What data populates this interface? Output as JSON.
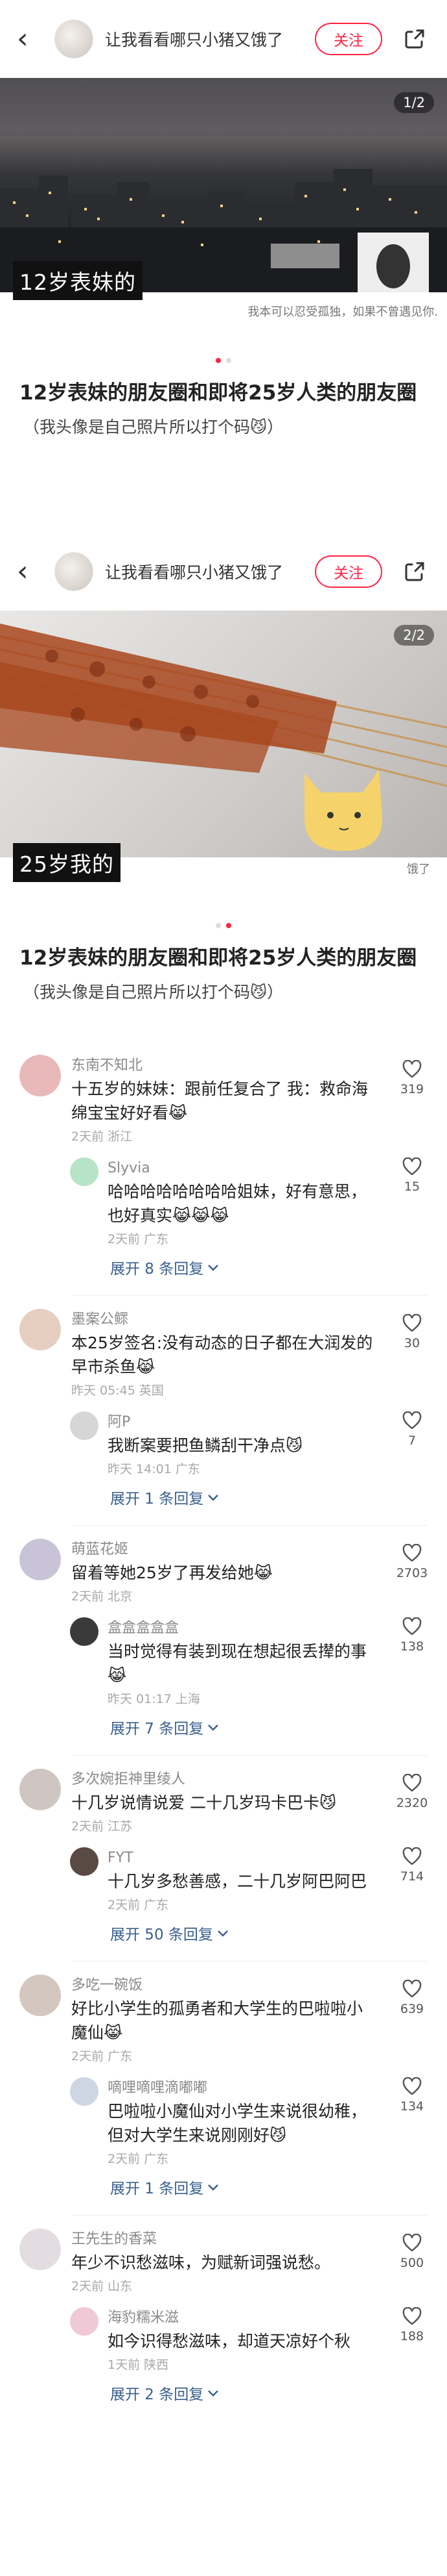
{
  "post1": {
    "header": {
      "username": "让我看看哪只小猪又饿了",
      "follow": "关注"
    },
    "page_indicator": "1/2",
    "caption": "12岁表妹的",
    "small_caption": "我本可以忍受孤独，如果不曾遇见你.",
    "title": "12岁表妹的朋友圈和即将25岁人类的朋友圈",
    "subtitle": "（我头像是自己照片所以打个码😼）"
  },
  "post2": {
    "header": {
      "username": "让我看看哪只小猪又饿了",
      "follow": "关注"
    },
    "page_indicator": "2/2",
    "caption": "25岁我的",
    "small_caption": "饿了",
    "title": "12岁表妹的朋友圈和即将25岁人类的朋友圈",
    "subtitle": "（我头像是自己照片所以打个码😼）"
  },
  "comments": [
    {
      "name": "东南不知北",
      "text": "十五岁的妹妹：跟前任复合了 我：救命海绵宝宝好好看😹",
      "meta": "2天前 浙江",
      "likes": "319",
      "avatar_color": "#e9b8b8",
      "replies": [
        {
          "name": "Slyvia",
          "text": "哈哈哈哈哈哈哈哈姐妹，好有意思，也好真实😹😹😹",
          "meta": "2天前 广东",
          "likes": "15",
          "avatar_color": "#b7e3c6"
        }
      ],
      "expand": "展开 8 条回复"
    },
    {
      "name": "墨案公鳏",
      "text": "本25岁签名:没有动态的日子都在大润发的早市杀鱼😹",
      "meta": "昨天 05:45 英国",
      "likes": "30",
      "avatar_color": "#e6cfc0",
      "replies": [
        {
          "name": "阿P",
          "text": "我断案要把鱼鳞刮干净点😼",
          "meta": "昨天 14:01 广东",
          "likes": "7",
          "avatar_color": "#d6d6d6"
        }
      ],
      "expand": "展开 1 条回复"
    },
    {
      "name": "萌蓝花姬",
      "text": "留着等她25岁了再发给她😹",
      "meta": "2天前 北京",
      "likes": "2703",
      "avatar_color": "#c9c3d8",
      "replies": [
        {
          "name": "盒盒盒盒盒",
          "text": "当时觉得有装到现在想起很丢撵的事😹",
          "meta": "昨天 01:17 上海",
          "likes": "138",
          "avatar_color": "#3a3a3a"
        }
      ],
      "expand": "展开 7 条回复"
    },
    {
      "name": "多次婉拒神里绫人",
      "text": "十几岁说情说爱 二十几岁玛卡巴卡😼",
      "meta": "2天前 江苏",
      "likes": "2320",
      "avatar_color": "#cfc6c1",
      "replies": [
        {
          "name": "FYT",
          "text": "十几岁多愁善感，二十几岁阿巴阿巴",
          "meta": "2天前 广东",
          "likes": "714",
          "avatar_color": "#5a4a44"
        }
      ],
      "expand": "展开 50 条回复"
    },
    {
      "name": "多吃一碗饭",
      "text": "好比小学生的孤勇者和大学生的巴啦啦小魔仙😹",
      "meta": "2天前 广东",
      "likes": "639",
      "avatar_color": "#d3c7c0",
      "replies": [
        {
          "name": "嘀哩嘀哩滴嘟嘟",
          "text": "巴啦啦小魔仙对小学生来说很幼稚，但对大学生来说刚刚好😼",
          "meta": "2天前 广东",
          "likes": "134",
          "avatar_color": "#cdd6e2"
        }
      ],
      "expand": "展开 1 条回复"
    },
    {
      "name": "王先生的香菜",
      "text": "年少不识愁滋味，为赋新词强说愁。",
      "meta": "2天前 山东",
      "likes": "500",
      "avatar_color": "#e3dde2",
      "replies": [
        {
          "name": "海豹糯米滋",
          "text": "如今识得愁滋味，却道天凉好个秋",
          "meta": "1天前 陕西",
          "likes": "188",
          "avatar_color": "#f0c9d6"
        }
      ],
      "expand": "展开 2 条回复"
    }
  ]
}
